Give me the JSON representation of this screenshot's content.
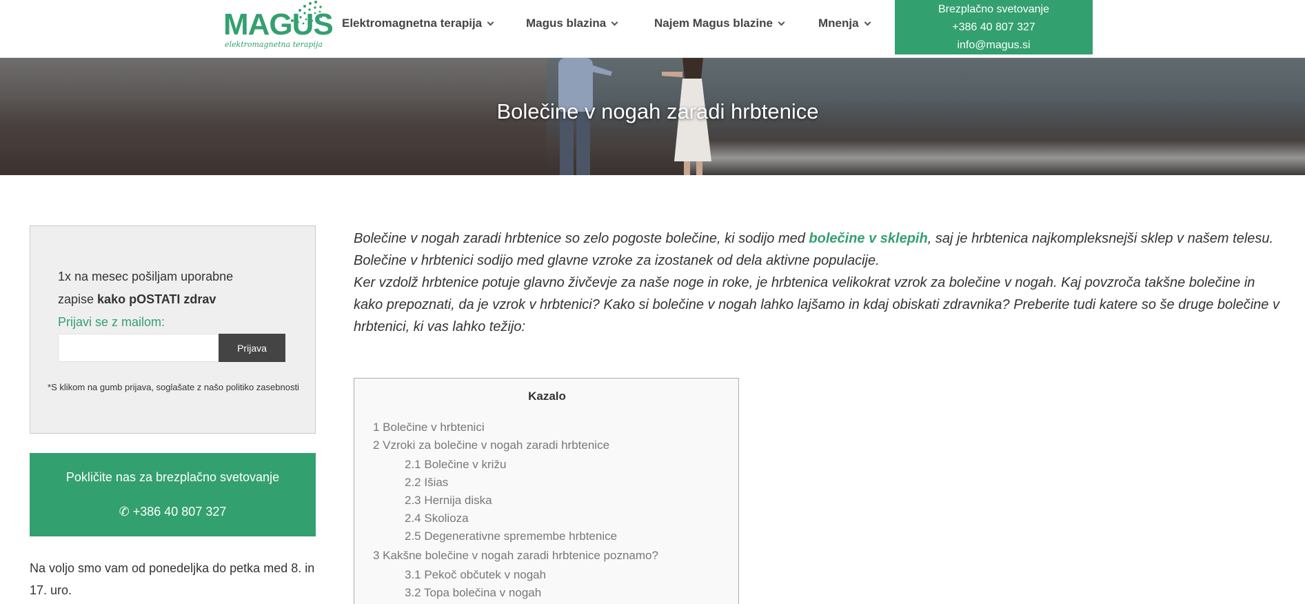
{
  "colors": {
    "accent": "#33a06f",
    "dark_button": "#444444",
    "text": "#333333",
    "toc_link": "#777777"
  },
  "logo": {
    "word": "MAGUS",
    "tagline": "elektromagnetna terapija",
    "icon": "dotted-arc-icon"
  },
  "nav": {
    "items": [
      {
        "label": "Elektromagnetna terapija"
      },
      {
        "label": "Magus blazina"
      },
      {
        "label": "Najem Magus blazine"
      },
      {
        "label": "Mnenja"
      }
    ],
    "dropdown_icon": "chevron-down-icon"
  },
  "contact": {
    "line1": "Brezplačno svetovanje",
    "phone": "+386 40 807 327",
    "email": "info@magus.si"
  },
  "hero": {
    "title": "Bolečine v nogah zaradi hrbtenice"
  },
  "subscribe": {
    "line1": "1x na mesec pošiljam uporabne",
    "line2_prefix": "zapise ",
    "line2_bold": "kako pOSTATI zdrav",
    "label": "Prijavi se z mailom:",
    "email_value": "",
    "button": "Prijava",
    "note": "*S klikom na gumb prijava, soglašate z našo politiko zasebnosti"
  },
  "call": {
    "line1": "Pokličite nas za brezplačno svetovanje",
    "icon": "phone-icon",
    "phone_line": "✆ +386 40 807 327"
  },
  "hours": {
    "text": "Na voljo smo vam od ponedeljka do petka med 8. in 17. uro."
  },
  "intro": {
    "p1_before": "Bolečine v nogah zaradi hrbtenice so zelo pogoste bolečine, ki sodijo med ",
    "p1_link": "bolečine v sklepih",
    "p1_after": ", saj je hrbtenica najkompleksnejši sklep v našem telesu.",
    "p2": "Bolečine v hrbtenici sodijo med glavne vzroke za izostanek od dela aktivne populacije.",
    "p3": "Ker vzdolž hrbtenice potuje glavno živčevje za naše noge in roke, je hrbtenica velikokrat vzrok za bolečine v nogah. Kaj povzroča takšne bolečine in kako prepoznati, da je vzrok v hrbtenici? Kako si bolečine v nogah lahko lajšamo in kdaj obiskati zdravnika? Preberite tudi katere so še druge bolečine v hrbtenici, ki vas lahko težijo:"
  },
  "toc": {
    "title": "Kazalo",
    "items": [
      {
        "label": "1 Bolečine v hrbtenici",
        "level": 1
      },
      {
        "label": "2 Vzroki za bolečine v nogah zaradi hrbtenice",
        "level": 1
      },
      {
        "label": "2.1 Bolečine v križu",
        "level": 2
      },
      {
        "label": "2.2 Išias",
        "level": 2
      },
      {
        "label": "2.3 Hernija diska",
        "level": 2
      },
      {
        "label": "2.4 Skolioza",
        "level": 2
      },
      {
        "label": "2.5 Degenerativne spremembe hrbtenice",
        "level": 2
      },
      {
        "label": "3 Kakšne bolečine v nogah zaradi hrbtenice poznamo?",
        "level": 1
      },
      {
        "label": "3.1 Pekoč občutek v nogah",
        "level": 2
      },
      {
        "label": "3.2 Topa bolečina v nogah",
        "level": 2
      }
    ]
  }
}
